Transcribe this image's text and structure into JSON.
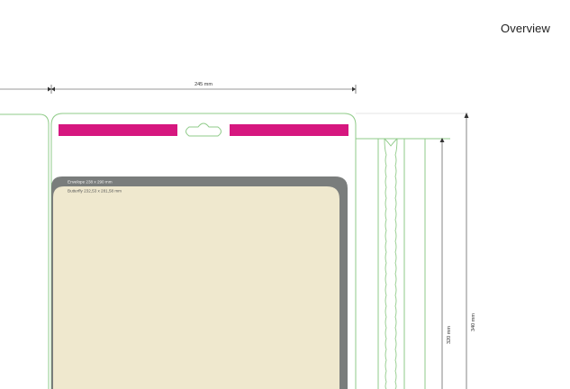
{
  "header": {
    "title": "Overview"
  },
  "dimensions": {
    "width_label": "245 mm",
    "inner_height_label": "320 mm",
    "outer_height_label": "340 mm"
  },
  "labels": {
    "envelope": "Envelope 238 x 290 mm",
    "butterfly": "Butterfly 232,53 x 281,58 mm"
  },
  "colors": {
    "accent_magenta": "#D6177F",
    "outline_green": "#8FCB88",
    "envelope_gray": "#7A7D7C",
    "butterfly_cream": "#EFE8CE",
    "dimension_line": "#333333"
  }
}
